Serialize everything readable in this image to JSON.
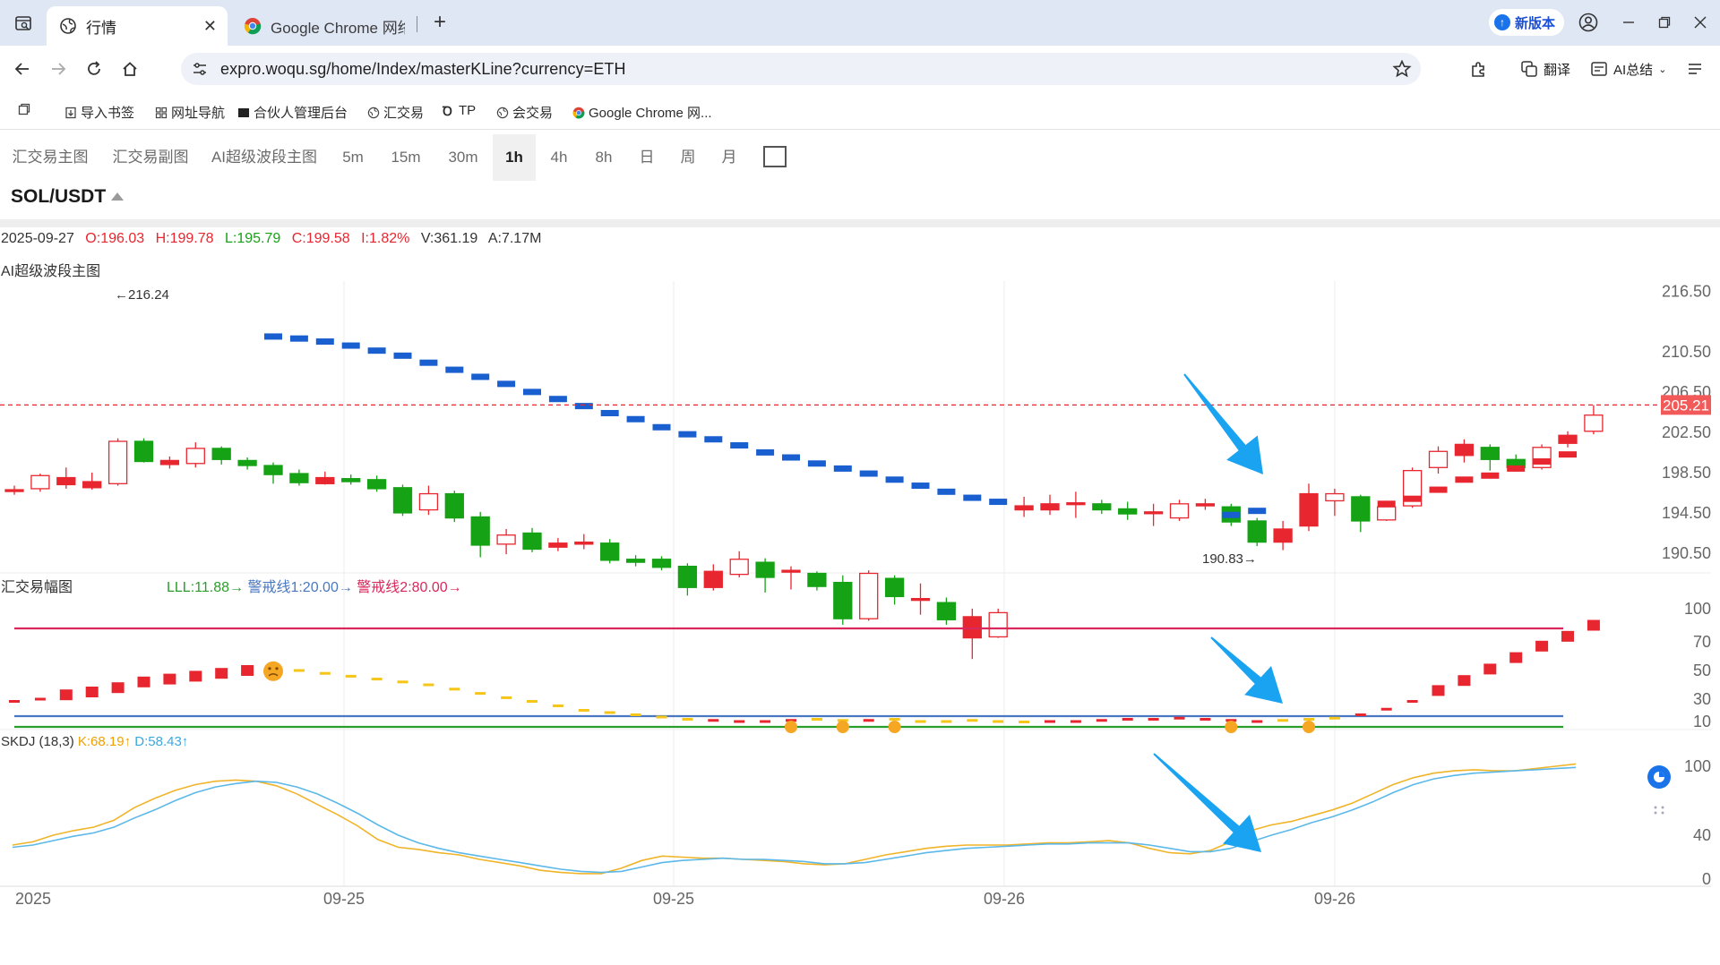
{
  "browser": {
    "tabs": [
      {
        "label": "行情",
        "active": true
      },
      {
        "label": "Google Chrome 网络",
        "active": false
      }
    ],
    "new_version_label": "新版本",
    "url": "expro.woqu.sg/home/Index/masterKLine?currency=ETH",
    "translate_label": "翻译",
    "ai_summary_label": "AI总结",
    "bookmarks": [
      "导入书签",
      "网址导航",
      "合伙人管理后台",
      "汇交易",
      "TP",
      "会交易",
      "Google Chrome 网..."
    ]
  },
  "page": {
    "period_tabs": [
      "汇交易主图",
      "汇交易副图",
      "AI超级波段主图",
      "5m",
      "15m",
      "30m",
      "1h",
      "4h",
      "8h",
      "日",
      "周",
      "月"
    ],
    "active_period": "1h",
    "symbol": "SOL/USDT",
    "ohlc": {
      "date": "2025-09-27",
      "open": "O:196.03",
      "high": "H:199.78",
      "low": "L:195.79",
      "close": "C:199.58",
      "change": "I:1.82%",
      "volume": "V:361.19",
      "amount": "A:7.17M"
    },
    "main_panel_label": "AI超级波段主图",
    "sub_panel_label": "汇交易幅图",
    "sub_legend": {
      "lll": "LLL:11.88→",
      "warn1": "警戒线1:20.00→",
      "warn2": "警戒线2:80.00→"
    },
    "skdj": {
      "name": "SKDJ (18,3)",
      "k": "K:68.19↑",
      "d": "D:58.43↑"
    },
    "x_axis_labels": [
      "2025",
      "09-25",
      "09-25",
      "09-26",
      "09-26"
    ]
  },
  "colors": {
    "up": "#e8262f",
    "down": "#15a215",
    "band": "#1a5fd0",
    "arrow": "#1aa3f0",
    "warn2_line": "#d8285c",
    "warn1_line": "#4a78c0",
    "lll_line": "#2a9d2a",
    "k_line": "#f0b429",
    "d_line": "#5bb8e8"
  },
  "chart_data": [
    {
      "type": "candlestick",
      "y_ticks": [
        216.5,
        210.5,
        206.5,
        202.5,
        198.5,
        194.5,
        190.5
      ],
      "ylim": [
        188.9,
        217.5
      ],
      "current_price": "205.21",
      "max_label": "←216.24",
      "min_label": "190.83→",
      "candles": [
        {
          "o": 196.8,
          "c": 196.8,
          "h": 197.2,
          "l": 196.3
        },
        {
          "o": 196.9,
          "c": 198.2,
          "h": 198.4,
          "l": 196.6
        },
        {
          "o": 197.3,
          "c": 198.0,
          "h": 199.0,
          "l": 196.9
        },
        {
          "o": 197.0,
          "c": 197.6,
          "h": 198.5,
          "l": 196.8
        },
        {
          "o": 197.4,
          "c": 201.6,
          "h": 201.9,
          "l": 197.2
        },
        {
          "o": 201.6,
          "c": 199.6,
          "h": 201.9,
          "l": 199.5
        },
        {
          "o": 199.3,
          "c": 199.7,
          "h": 200.1,
          "l": 198.9
        },
        {
          "o": 199.4,
          "c": 200.9,
          "h": 201.5,
          "l": 199.0
        },
        {
          "o": 200.9,
          "c": 199.8,
          "h": 201.1,
          "l": 199.3
        },
        {
          "o": 199.7,
          "c": 199.2,
          "h": 200.0,
          "l": 198.8
        },
        {
          "o": 199.2,
          "c": 198.3,
          "h": 199.5,
          "l": 197.4
        },
        {
          "o": 198.4,
          "c": 197.5,
          "h": 198.8,
          "l": 197.2
        },
        {
          "o": 197.4,
          "c": 198.0,
          "h": 198.6,
          "l": 197.3
        },
        {
          "o": 197.9,
          "c": 197.6,
          "h": 198.3,
          "l": 197.3
        },
        {
          "o": 197.8,
          "c": 196.9,
          "h": 198.2,
          "l": 196.6
        },
        {
          "o": 197.0,
          "c": 194.5,
          "h": 197.3,
          "l": 194.2
        },
        {
          "o": 194.8,
          "c": 196.4,
          "h": 197.2,
          "l": 194.3
        },
        {
          "o": 196.4,
          "c": 194.0,
          "h": 196.7,
          "l": 193.6
        },
        {
          "o": 194.1,
          "c": 191.3,
          "h": 194.6,
          "l": 190.1
        },
        {
          "o": 191.4,
          "c": 192.3,
          "h": 192.9,
          "l": 190.4
        },
        {
          "o": 192.5,
          "c": 190.9,
          "h": 193.0,
          "l": 190.6
        },
        {
          "o": 191.1,
          "c": 191.5,
          "h": 192.0,
          "l": 190.7
        },
        {
          "o": 191.4,
          "c": 191.6,
          "h": 192.4,
          "l": 190.9
        },
        {
          "o": 191.5,
          "c": 189.8,
          "h": 191.9,
          "l": 189.5
        },
        {
          "o": 189.9,
          "c": 189.6,
          "h": 190.3,
          "l": 189.2
        },
        {
          "o": 189.9,
          "c": 189.1,
          "h": 190.2,
          "l": 188.8
        },
        {
          "o": 189.2,
          "c": 187.1,
          "h": 189.5,
          "l": 186.3
        },
        {
          "o": 187.1,
          "c": 188.7,
          "h": 189.4,
          "l": 186.8
        },
        {
          "o": 188.4,
          "c": 189.9,
          "h": 190.7,
          "l": 188.1
        },
        {
          "o": 189.6,
          "c": 188.1,
          "h": 190.0,
          "l": 186.6
        },
        {
          "o": 188.8,
          "c": 188.8,
          "h": 189.2,
          "l": 186.9
        },
        {
          "o": 188.5,
          "c": 187.2,
          "h": 188.7,
          "l": 186.8
        },
        {
          "o": 187.6,
          "c": 184.0,
          "h": 188.3,
          "l": 183.4
        },
        {
          "o": 184.0,
          "c": 188.5,
          "h": 188.8,
          "l": 183.8
        },
        {
          "o": 188.0,
          "c": 186.2,
          "h": 188.3,
          "l": 185.4
        },
        {
          "o": 186.0,
          "c": 186.0,
          "h": 187.5,
          "l": 184.4
        },
        {
          "o": 185.6,
          "c": 183.9,
          "h": 186.1,
          "l": 183.4
        },
        {
          "o": 182.1,
          "c": 184.2,
          "h": 185.0,
          "l": 180.0
        },
        {
          "o": 182.2,
          "c": 184.6,
          "h": 185.0,
          "l": 182.1
        },
        {
          "o": 194.8,
          "c": 195.2,
          "h": 196.1,
          "l": 194.1
        },
        {
          "o": 194.8,
          "c": 195.4,
          "h": 196.3,
          "l": 194.3
        },
        {
          "o": 195.5,
          "c": 195.5,
          "h": 196.6,
          "l": 194.0
        },
        {
          "o": 195.4,
          "c": 194.8,
          "h": 195.8,
          "l": 194.4
        },
        {
          "o": 194.9,
          "c": 194.4,
          "h": 195.6,
          "l": 193.8
        },
        {
          "o": 194.6,
          "c": 194.6,
          "h": 195.4,
          "l": 193.2
        },
        {
          "o": 194.0,
          "c": 195.4,
          "h": 195.8,
          "l": 193.7
        },
        {
          "o": 195.2,
          "c": 195.4,
          "h": 195.9,
          "l": 194.8
        },
        {
          "o": 195.1,
          "c": 193.6,
          "h": 195.4,
          "l": 193.2
        },
        {
          "o": 193.7,
          "c": 191.6,
          "h": 194.0,
          "l": 191.2
        },
        {
          "o": 191.6,
          "c": 192.9,
          "h": 193.7,
          "l": 190.8
        },
        {
          "o": 193.2,
          "c": 196.4,
          "h": 197.4,
          "l": 192.7
        },
        {
          "o": 195.7,
          "c": 196.4,
          "h": 196.9,
          "l": 194.2
        },
        {
          "o": 196.1,
          "c": 193.7,
          "h": 196.3,
          "l": 192.6
        },
        {
          "o": 193.8,
          "c": 195.1,
          "h": 195.7,
          "l": 193.7
        },
        {
          "o": 195.2,
          "c": 198.7,
          "h": 199.0,
          "l": 195.0
        },
        {
          "o": 199.0,
          "c": 200.6,
          "h": 201.1,
          "l": 198.4
        },
        {
          "o": 200.2,
          "c": 201.3,
          "h": 201.8,
          "l": 199.5
        },
        {
          "o": 201.0,
          "c": 199.8,
          "h": 201.3,
          "l": 198.7
        },
        {
          "o": 199.8,
          "c": 199.0,
          "h": 200.3,
          "l": 198.6
        },
        {
          "o": 199.0,
          "c": 201.0,
          "h": 201.3,
          "l": 198.8
        },
        {
          "o": 201.4,
          "c": 202.2,
          "h": 202.6,
          "l": 201.0
        },
        {
          "o": 202.6,
          "c": 204.2,
          "h": 205.2,
          "l": 202.3
        }
      ],
      "band_steps": [
        {
          "i": 10,
          "v": 212.0
        },
        {
          "i": 11,
          "v": 211.8
        },
        {
          "i": 12,
          "v": 211.5
        },
        {
          "i": 13,
          "v": 211.1
        },
        {
          "i": 14,
          "v": 210.6
        },
        {
          "i": 15,
          "v": 210.1
        },
        {
          "i": 16,
          "v": 209.4
        },
        {
          "i": 17,
          "v": 208.7
        },
        {
          "i": 18,
          "v": 208.0
        },
        {
          "i": 19,
          "v": 207.3
        },
        {
          "i": 20,
          "v": 206.5
        },
        {
          "i": 21,
          "v": 205.8
        },
        {
          "i": 22,
          "v": 205.1
        },
        {
          "i": 23,
          "v": 204.4
        },
        {
          "i": 24,
          "v": 203.8
        },
        {
          "i": 25,
          "v": 203.0
        },
        {
          "i": 26,
          "v": 202.3
        },
        {
          "i": 27,
          "v": 201.8
        },
        {
          "i": 28,
          "v": 201.2
        },
        {
          "i": 29,
          "v": 200.5
        },
        {
          "i": 30,
          "v": 200.0
        },
        {
          "i": 31,
          "v": 199.4
        },
        {
          "i": 32,
          "v": 198.9
        },
        {
          "i": 33,
          "v": 198.4
        },
        {
          "i": 34,
          "v": 197.8
        },
        {
          "i": 35,
          "v": 197.2
        },
        {
          "i": 36,
          "v": 196.6
        },
        {
          "i": 37,
          "v": 196.0
        },
        {
          "i": 38,
          "v": 195.6
        },
        {
          "i": 47,
          "v": 194.3
        },
        {
          "i": 48,
          "v": 194.7
        }
      ],
      "red_steps": [
        {
          "i": 53,
          "v": 195.4
        },
        {
          "i": 54,
          "v": 195.9
        },
        {
          "i": 55,
          "v": 196.8
        },
        {
          "i": 56,
          "v": 197.8
        },
        {
          "i": 57,
          "v": 198.2
        },
        {
          "i": 58,
          "v": 198.9
        },
        {
          "i": 59,
          "v": 199.6
        },
        {
          "i": 60,
          "v": 200.3
        }
      ]
    },
    {
      "type": "bar",
      "y_ticks": [
        100,
        70,
        50,
        30,
        10
      ],
      "ylim": [
        0,
        100
      ],
      "warn2": 80,
      "warn1": 20,
      "lll": 11.88,
      "values": [
        28,
        30,
        33,
        35,
        38,
        42,
        44,
        46,
        48,
        50,
        52,
        50,
        48,
        46,
        44,
        42,
        40,
        37,
        34,
        31,
        28,
        24,
        20,
        18,
        16,
        14,
        12,
        11,
        10,
        10,
        11,
        12,
        11,
        11,
        12,
        10,
        10,
        11,
        10,
        9,
        10,
        10,
        11,
        12,
        12,
        13,
        12,
        11,
        10,
        11,
        12,
        13,
        16,
        21,
        28,
        36,
        43,
        51,
        59,
        67,
        75,
        85
      ],
      "colors": [
        "r",
        "r",
        "r",
        "r",
        "r",
        "r",
        "r",
        "r",
        "r",
        "r",
        "y",
        "y",
        "y",
        "y",
        "y",
        "y",
        "y",
        "y",
        "y",
        "y",
        "y",
        "y",
        "y",
        "y",
        "y",
        "y",
        "y",
        "r",
        "r",
        "r",
        "r",
        "y",
        "y",
        "r",
        "y",
        "y",
        "y",
        "y",
        "y",
        "y",
        "r",
        "r",
        "r",
        "r",
        "r",
        "r",
        "r",
        "r",
        "r",
        "y",
        "y",
        "y",
        "r",
        "r",
        "r",
        "r",
        "r",
        "r",
        "r",
        "r",
        "r",
        "r"
      ],
      "faces": [
        10,
        30,
        32,
        34,
        47,
        50
      ]
    },
    {
      "type": "line",
      "y_ticks": [
        100,
        40,
        0
      ],
      "ylim": [
        -5,
        105
      ],
      "series": [
        {
          "name": "K",
          "values": [
            31,
            34,
            40,
            44,
            47,
            53,
            64,
            72,
            79,
            84,
            87,
            88,
            87,
            83,
            76,
            67,
            58,
            48,
            36,
            29,
            27,
            24,
            22,
            18,
            15,
            12,
            8,
            6,
            5,
            5,
            10,
            17,
            21,
            20,
            19,
            19,
            18,
            17,
            16,
            14,
            13,
            14,
            18,
            22,
            25,
            28,
            30,
            31,
            31,
            31,
            32,
            33,
            33,
            34,
            35,
            33,
            28,
            24,
            23,
            26,
            34,
            44,
            49,
            52,
            57,
            62,
            68,
            76,
            84,
            90,
            94,
            96,
            97,
            96,
            96,
            98,
            100,
            102
          ]
        },
        {
          "name": "D",
          "values": [
            29,
            31,
            35,
            39,
            42,
            47,
            55,
            62,
            70,
            77,
            82,
            85,
            87,
            86,
            82,
            76,
            68,
            59,
            49,
            40,
            33,
            28,
            24,
            21,
            18,
            15,
            12,
            9,
            7,
            6,
            7,
            11,
            15,
            17,
            18,
            19,
            18,
            18,
            17,
            16,
            14,
            14,
            15,
            18,
            21,
            24,
            26,
            28,
            29,
            30,
            31,
            32,
            32,
            33,
            33,
            33,
            31,
            28,
            25,
            25,
            28,
            34,
            40,
            45,
            51,
            56,
            62,
            69,
            77,
            84,
            89,
            92,
            94,
            95,
            96,
            97,
            98,
            99
          ]
        }
      ]
    }
  ]
}
